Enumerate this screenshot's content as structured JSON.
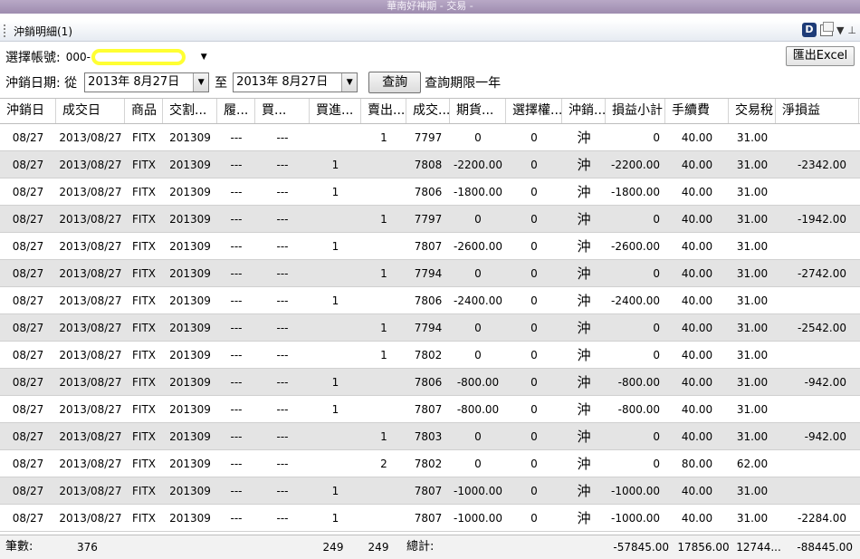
{
  "window": {
    "title": "華南好神期 - 交易 -"
  },
  "panel": {
    "title": "沖銷明細(1)",
    "d_icon": "D",
    "icons": [
      "d-app-icon",
      "window-icon",
      "dropdown-icon",
      "pin-icon"
    ]
  },
  "account": {
    "label": "選擇帳號:",
    "value": "000-"
  },
  "dates": {
    "label": "沖銷日期: 從",
    "from": "2013年  8月27日",
    "to_label": "至",
    "to": "2013年  8月27日"
  },
  "query": {
    "label": "查詢",
    "note": "查詢期限一年"
  },
  "export": {
    "label": "匯出Excel"
  },
  "table": {
    "headers": [
      "沖銷日",
      "成交日",
      "商品",
      "交割...",
      "履...",
      "買...",
      "買進...",
      "賣出...",
      "成交...",
      "期貨...",
      "選擇權...",
      "沖銷...",
      "損益小計",
      "手續費",
      "交易稅",
      "淨損益"
    ],
    "rows": [
      [
        "08/27",
        "2013/08/27",
        "FITX",
        "201309",
        "---",
        "---",
        "",
        "1",
        "7797",
        "0",
        "0",
        "沖",
        "0",
        "40.00",
        "31.00",
        ""
      ],
      [
        "08/27",
        "2013/08/27",
        "FITX",
        "201309",
        "---",
        "---",
        "1",
        "",
        "7808",
        "-2200.00",
        "0",
        "沖",
        "-2200.00",
        "40.00",
        "31.00",
        "-2342.00"
      ],
      [
        "08/27",
        "2013/08/27",
        "FITX",
        "201309",
        "---",
        "---",
        "1",
        "",
        "7806",
        "-1800.00",
        "0",
        "沖",
        "-1800.00",
        "40.00",
        "31.00",
        ""
      ],
      [
        "08/27",
        "2013/08/27",
        "FITX",
        "201309",
        "---",
        "---",
        "",
        "1",
        "7797",
        "0",
        "0",
        "沖",
        "0",
        "40.00",
        "31.00",
        "-1942.00"
      ],
      [
        "08/27",
        "2013/08/27",
        "FITX",
        "201309",
        "---",
        "---",
        "1",
        "",
        "7807",
        "-2600.00",
        "0",
        "沖",
        "-2600.00",
        "40.00",
        "31.00",
        ""
      ],
      [
        "08/27",
        "2013/08/27",
        "FITX",
        "201309",
        "---",
        "---",
        "",
        "1",
        "7794",
        "0",
        "0",
        "沖",
        "0",
        "40.00",
        "31.00",
        "-2742.00"
      ],
      [
        "08/27",
        "2013/08/27",
        "FITX",
        "201309",
        "---",
        "---",
        "1",
        "",
        "7806",
        "-2400.00",
        "0",
        "沖",
        "-2400.00",
        "40.00",
        "31.00",
        ""
      ],
      [
        "08/27",
        "2013/08/27",
        "FITX",
        "201309",
        "---",
        "---",
        "",
        "1",
        "7794",
        "0",
        "0",
        "沖",
        "0",
        "40.00",
        "31.00",
        "-2542.00"
      ],
      [
        "08/27",
        "2013/08/27",
        "FITX",
        "201309",
        "---",
        "---",
        "",
        "1",
        "7802",
        "0",
        "0",
        "沖",
        "0",
        "40.00",
        "31.00",
        ""
      ],
      [
        "08/27",
        "2013/08/27",
        "FITX",
        "201309",
        "---",
        "---",
        "1",
        "",
        "7806",
        "-800.00",
        "0",
        "沖",
        "-800.00",
        "40.00",
        "31.00",
        "-942.00"
      ],
      [
        "08/27",
        "2013/08/27",
        "FITX",
        "201309",
        "---",
        "---",
        "1",
        "",
        "7807",
        "-800.00",
        "0",
        "沖",
        "-800.00",
        "40.00",
        "31.00",
        ""
      ],
      [
        "08/27",
        "2013/08/27",
        "FITX",
        "201309",
        "---",
        "---",
        "",
        "1",
        "7803",
        "0",
        "0",
        "沖",
        "0",
        "40.00",
        "31.00",
        "-942.00"
      ],
      [
        "08/27",
        "2013/08/27",
        "FITX",
        "201309",
        "---",
        "---",
        "",
        "2",
        "7802",
        "0",
        "0",
        "沖",
        "0",
        "80.00",
        "62.00",
        ""
      ],
      [
        "08/27",
        "2013/08/27",
        "FITX",
        "201309",
        "---",
        "---",
        "1",
        "",
        "7807",
        "-1000.00",
        "0",
        "沖",
        "-1000.00",
        "40.00",
        "31.00",
        ""
      ],
      [
        "08/27",
        "2013/08/27",
        "FITX",
        "201309",
        "---",
        "---",
        "1",
        "",
        "7807",
        "-1000.00",
        "0",
        "沖",
        "-1000.00",
        "40.00",
        "31.00",
        "-2284.00"
      ]
    ]
  },
  "footer": {
    "count_label": "筆數:",
    "count": "376",
    "buy_total": "249",
    "sell_total": "249",
    "total_label": "總計:",
    "pnl_subtotal": "-57845.00",
    "fee": "17856.00",
    "tax": "12744...",
    "net_pnl": "-88445.00"
  }
}
